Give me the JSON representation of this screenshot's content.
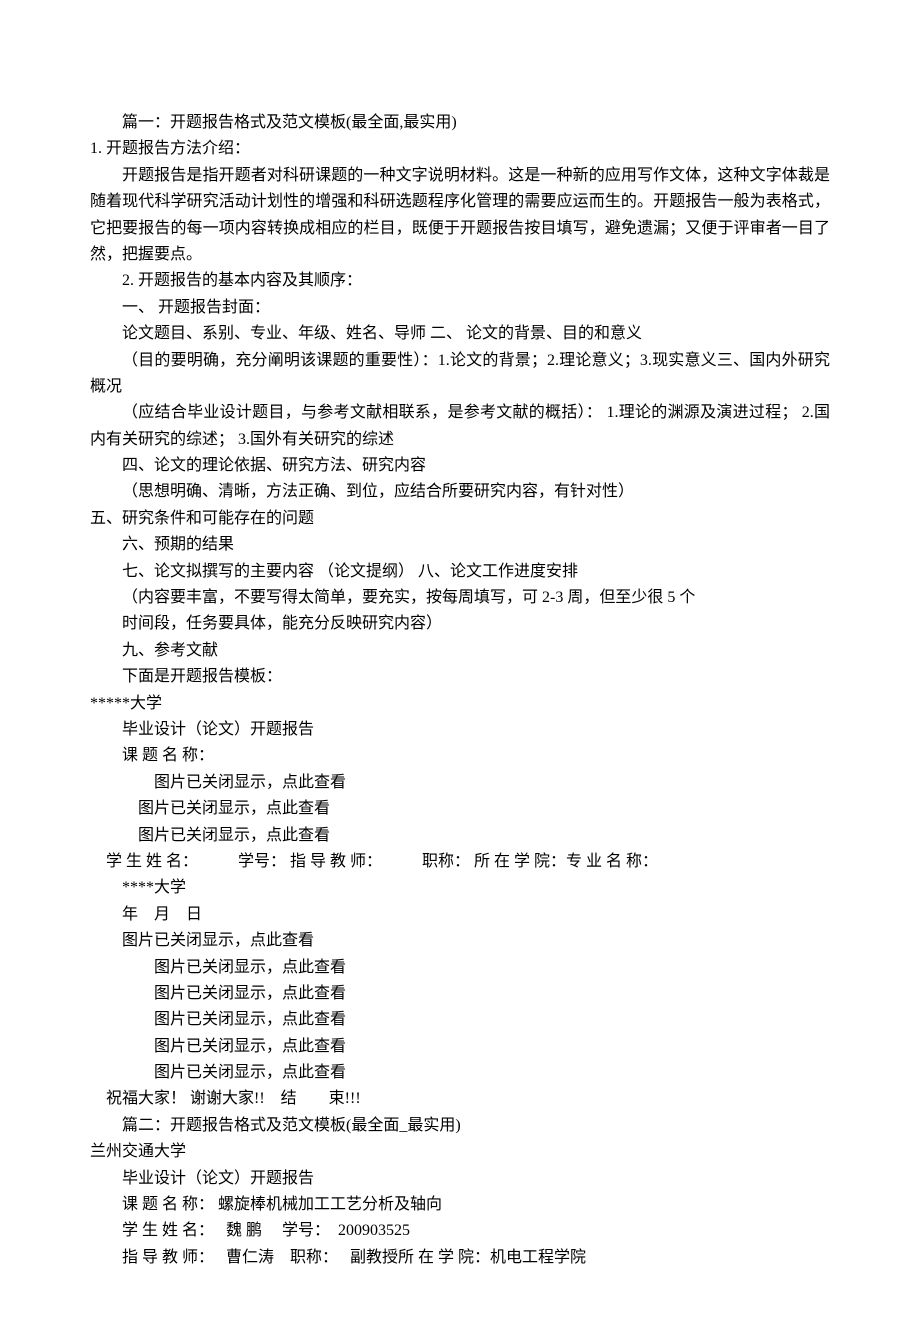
{
  "lines": [
    {
      "cls": "para indent2",
      "text": "篇一：开题报告格式及范文模板(最全面,最实用)"
    },
    {
      "cls": "para indent0",
      "text": "1. 开题报告方法介绍："
    },
    {
      "cls": "para indent2",
      "text": "开题报告是指开题者对科研课题的一种文字说明材料。这是一种新的应用写作文体，这种文字体裁是随着现代科学研究活动计划性的增强和科研选题程序化管理的需要应运而生的。开题报告一般为表格式，它把要报告的每一项内容转换成相应的栏目，既便于开题报告按目填写，避免遗漏；又便于评审者一目了然，把握要点。"
    },
    {
      "cls": "para indent2",
      "text": "2. 开题报告的基本内容及其顺序："
    },
    {
      "cls": "para indent2",
      "text": "一、 开题报告封面："
    },
    {
      "cls": "para indent2",
      "text": "论文题目、系别、专业、年级、姓名、导师 二、 论文的背景、目的和意义"
    },
    {
      "cls": "para indent2",
      "text": "（目的要明确，充分阐明该课题的重要性）：1.论文的背景；2.理论意义；3.现实意义三、国内外研究概况"
    },
    {
      "cls": "para indent2",
      "text": "（应结合毕业设计题目，与参考文献相联系，是参考文献的概括）： 1.理论的渊源及演进过程； 2.国内有关研究的综述； 3.国外有关研究的综述"
    },
    {
      "cls": "para indent2",
      "text": "四、论文的理论依据、研究方法、研究内容"
    },
    {
      "cls": "para indent2",
      "text": "（思想明确、清晰，方法正确、到位，应结合所要研究内容，有针对性）"
    },
    {
      "cls": "para indent0",
      "text": "五、研究条件和可能存在的问题"
    },
    {
      "cls": "para indent2",
      "text": "六、预期的结果"
    },
    {
      "cls": "para indent2",
      "text": "七、论文拟撰写的主要内容 （论文提纲）  八、论文工作进度安排"
    },
    {
      "cls": "para indent2",
      "text": "（内容要丰富，不要写得太简单，要充实，按每周填写，可 2-3 周，但至少很 5 个"
    },
    {
      "cls": "para indent2",
      "text": "时间段，任务要具体，能充分反映研究内容）"
    },
    {
      "cls": "para indent2",
      "text": "九、参考文献"
    },
    {
      "cls": "para indent2",
      "text": "下面是开题报告模板："
    },
    {
      "cls": "para indent0",
      "text": "*****大学"
    },
    {
      "cls": "para indent2",
      "text": "毕业设计（论文）开题报告"
    },
    {
      "cls": "para indent2",
      "text": "课 题 名 称："
    },
    {
      "cls": "para indent4",
      "text": "图片已关闭显示，点此查看"
    },
    {
      "cls": "para indent3",
      "text": "图片已关闭显示，点此查看"
    },
    {
      "cls": "para indent3",
      "text": "图片已关闭显示，点此查看"
    },
    {
      "cls": "para indent1",
      "text": "学 生 姓 名：　　　学号： 指 导 教 师：　　　职称： 所 在 学 院：专 业 名 称："
    },
    {
      "cls": "para indent2",
      "text": "****大学"
    },
    {
      "cls": "para indent2",
      "text": "年　月　日"
    },
    {
      "cls": "para indent2",
      "text": "图片已关闭显示，点此查看"
    },
    {
      "cls": "para indent4",
      "text": "图片已关闭显示，点此查看"
    },
    {
      "cls": "para indent4",
      "text": "图片已关闭显示，点此查看"
    },
    {
      "cls": "para indent4",
      "text": "图片已关闭显示，点此查看"
    },
    {
      "cls": "para indent4",
      "text": "图片已关闭显示，点此查看"
    },
    {
      "cls": "para indent4",
      "text": "图片已关闭显示，点此查看"
    },
    {
      "cls": "para indent1",
      "text": "祝福大家！ 谢谢大家!!　结　　束!!!"
    },
    {
      "cls": "para indent2",
      "text": "篇二：开题报告格式及范文模板(最全面_最实用)"
    },
    {
      "cls": "para indent0",
      "text": "兰州交通大学"
    },
    {
      "cls": "para indent2",
      "text": "毕业设计（论文）开题报告"
    },
    {
      "cls": "para indent2",
      "text": "课 题 名 称： 螺旋棒机械加工工艺分析及轴向"
    },
    {
      "cls": "para indent2",
      "text": "学 生 姓 名：　 魏 鹏　 学号：　200903525"
    },
    {
      "cls": "para indent2",
      "text": "指 导 教 师：　 曹仁涛　职称：　 副教授所 在 学 院：机电工程学院"
    }
  ]
}
